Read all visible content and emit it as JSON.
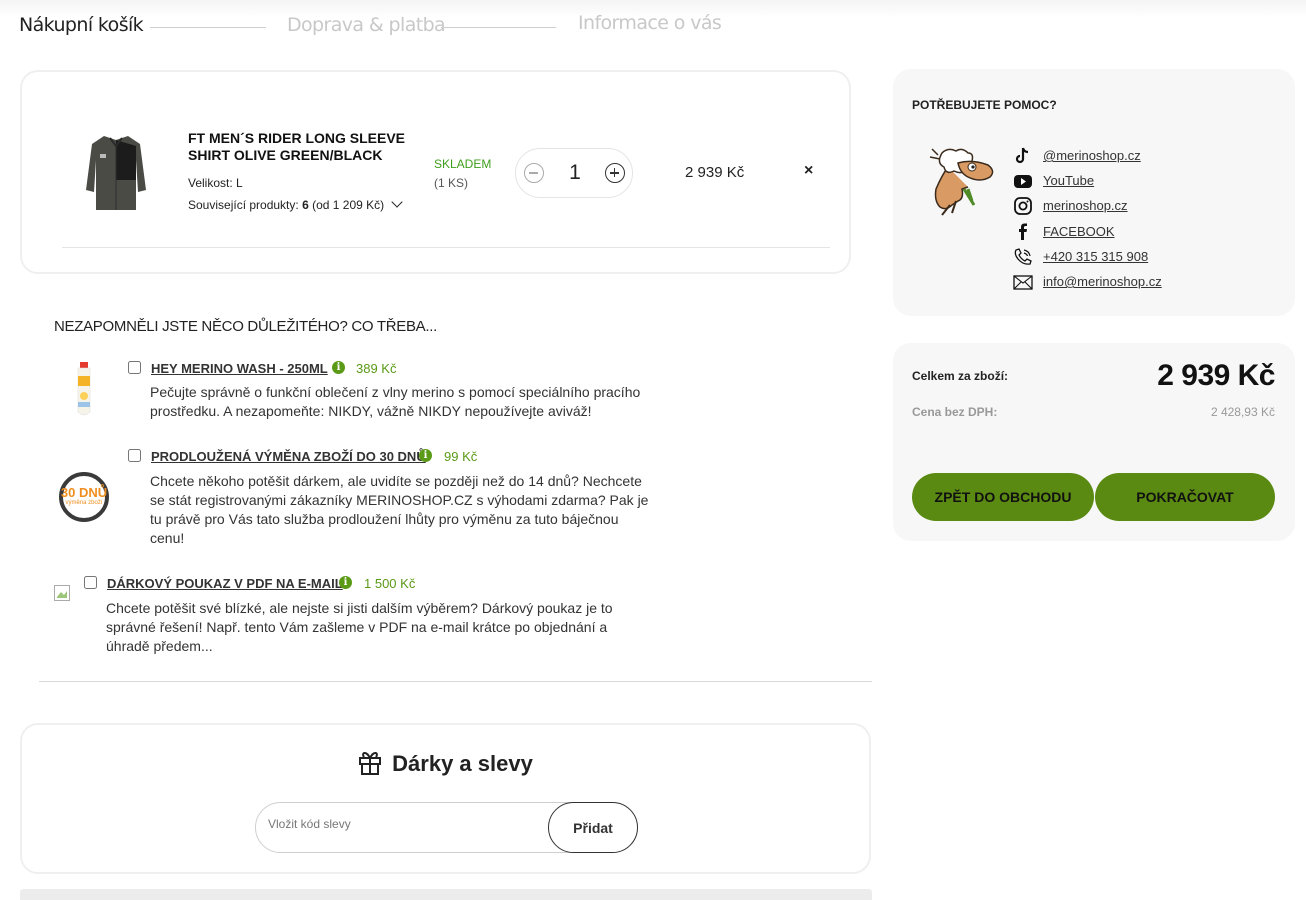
{
  "steps": [
    {
      "label": "Nákupní košík",
      "state": "active"
    },
    {
      "label": "Doprava & platba",
      "state": "inactive"
    },
    {
      "label": "Informace o vás",
      "state": "inactive"
    }
  ],
  "cart": {
    "item": {
      "name": "FT MEN´S RIDER LONG SLEEVE SHIRT OLIVE GREEN/BLACK",
      "size": "Velikost: L",
      "related_prefix": "Související produkty: ",
      "related_count": "6",
      "related_suffix": " (od 1 209 Kč)",
      "stock_status": "SKLADEM",
      "stock_qty": "(1 KS)",
      "quantity": "1",
      "price": "2 939 Kč",
      "remove_label": "×"
    }
  },
  "upsell": {
    "title": "NEZAPOMNĚLI JSTE NĚCO DŮLEŽITÉHO? CO TŘEBA...",
    "items": [
      {
        "name": "HEY MERINO WASH - 250ML",
        "price": "389 Kč",
        "desc": "Pečujte správně o funkční oblečení z vlny merino s pomocí speciálního pracího prostředku. A nezapomeňte: NIKDY, vážně NIKDY nepoužívejte aviváž!"
      },
      {
        "name": "PRODLOUŽENÁ VÝMĚNA ZBOŽÍ DO 30 DNŮ",
        "price": "99 Kč",
        "badge_main": "30 DNŮ",
        "badge_sub": "výměna zboží",
        "desc": "Chcete někoho potěšit dárkem, ale uvidíte se později než do 14 dnů? Nechcete se stát registrovanými zákazníky MERINOSHOP.CZ s výhodami zdarma? Pak je tu právě pro Vás tato služba prodloužení lhůty pro výměnu za tuto báječnou cenu!"
      },
      {
        "name": "DÁRKOVÝ POUKAZ V PDF NA E-MAIL",
        "price": "1 500 Kč",
        "desc": "Chcete potěšit své blízké, ale nejste si jisti dalším výběrem? Dárkový poukaz je to správné řešení! Např. tento Vám zašleme v PDF na e-mail krátce po objednání a úhradě předem..."
      }
    ]
  },
  "gifts": {
    "title": "Dárky a slevy",
    "input_placeholder": "Vložit kód slevy",
    "button": "Přidat"
  },
  "help": {
    "title": "POTŘEBUJETE POMOC?",
    "contacts": [
      {
        "icon": "tiktok-icon",
        "label": "@merinoshop.cz"
      },
      {
        "icon": "youtube-icon",
        "label": "YouTube"
      },
      {
        "icon": "instagram-icon",
        "label": "merinoshop.cz"
      },
      {
        "icon": "facebook-icon",
        "label": "FACEBOOK"
      },
      {
        "icon": "phone-icon",
        "label": "+420 315 315 908"
      },
      {
        "icon": "mail-icon",
        "label": "info@merinoshop.cz"
      }
    ]
  },
  "summary": {
    "total_label": "Celkem za zboží:",
    "total_value": "2 939 Kč",
    "vat_label": "Cena bez DPH:",
    "vat_value": "2 428,93 Kč",
    "back_button": "ZPĚT DO OBCHODU",
    "continue_button": "POKRAČOVAT"
  },
  "colors": {
    "accent_green": "#5a8a12",
    "price_green": "#5a9a16",
    "stock_green": "#3f9e1d"
  }
}
